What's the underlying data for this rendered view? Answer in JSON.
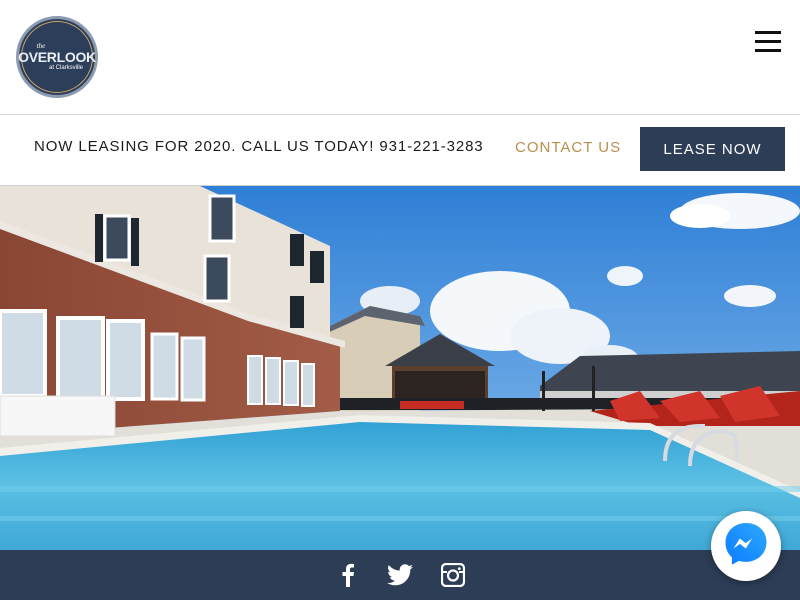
{
  "header": {
    "logo": {
      "the": "the",
      "name": "OVERLOOK",
      "sub": "at Clarksville"
    },
    "menu_icon": "hamburger-icon"
  },
  "announcement": {
    "text": "NOW LEASING FOR 2020. CALL US TODAY! 931-221-3283",
    "contact_label": "CONTACT US",
    "lease_label": "LEASE NOW"
  },
  "hero": {
    "image": "pool-photo"
  },
  "footer": {
    "social": [
      {
        "icon": "facebook-icon"
      },
      {
        "icon": "twitter-icon"
      },
      {
        "icon": "instagram-icon"
      }
    ]
  },
  "chat": {
    "icon": "messenger-icon"
  },
  "colors": {
    "navy": "#2d3d56",
    "gold": "#b88f4d",
    "pool": "#4ab0d8"
  }
}
